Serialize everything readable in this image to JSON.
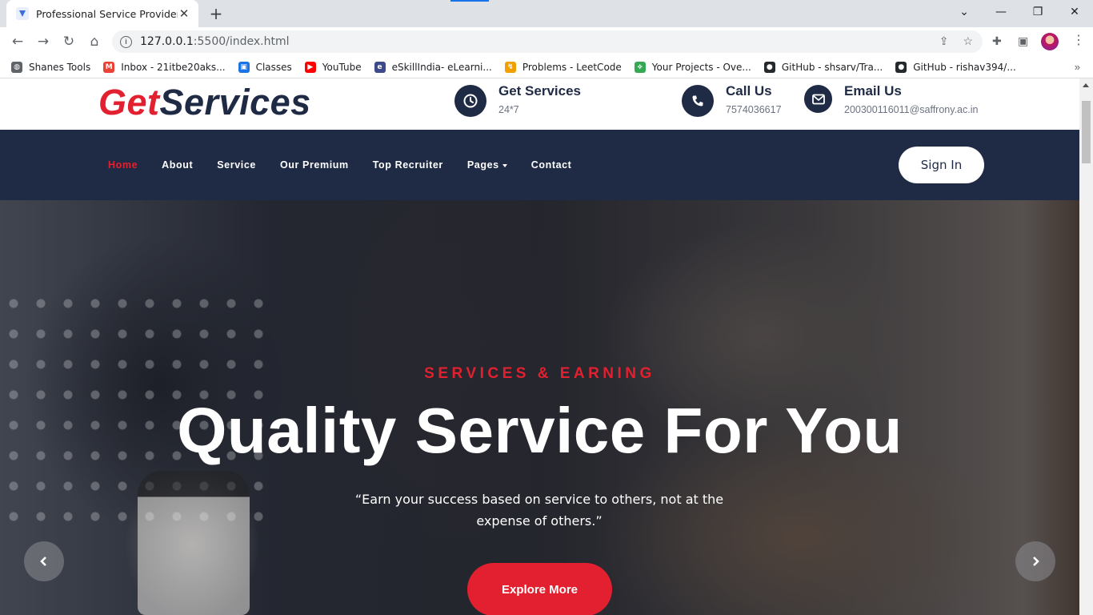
{
  "browser": {
    "tab_title": "Professional Service Provider",
    "url_host": "127.0.0.1",
    "url_path": ":5500/index.html",
    "bookmarks": [
      {
        "label": "Shanes Tools",
        "color": "#5f6368"
      },
      {
        "label": "Inbox - 21itbe20aks...",
        "color": "#ea4335"
      },
      {
        "label": "Classes",
        "color": "#1a73e8"
      },
      {
        "label": "YouTube",
        "color": "#ff0000"
      },
      {
        "label": "eSkillIndia- eLearni...",
        "color": "#3c4a8c"
      },
      {
        "label": "Problems - LeetCode",
        "color": "#f0a000"
      },
      {
        "label": "Your Projects - Ove...",
        "color": "#34a853"
      },
      {
        "label": "GitHub - shsarv/Tra...",
        "color": "#24292e"
      },
      {
        "label": "GitHub - rishav394/...",
        "color": "#24292e"
      }
    ],
    "bookmarks_more": "»"
  },
  "site": {
    "logo_part1": "Get",
    "logo_part2": "Services",
    "contacts": [
      {
        "title": "Get Services",
        "value": "24*7",
        "icon": "clock-icon"
      },
      {
        "title": "Call Us",
        "value": "7574036617",
        "icon": "phone-icon"
      },
      {
        "title": "Email Us",
        "value": "200300116011@saffrony.ac.in",
        "icon": "envelope-icon"
      }
    ],
    "nav": [
      "Home",
      "About",
      "Service",
      "Our Premium",
      "Top Recruiter",
      "Pages",
      "Contact"
    ],
    "signin": "Sign In"
  },
  "hero": {
    "tag": "SERVICES & EARNING",
    "headline": "Quality Service For You",
    "quote": "“Earn your success based on service to others, not at the expense of others.”",
    "button": "Explore More"
  },
  "colors": {
    "accent": "#e3202f",
    "navy": "#1f2a44"
  }
}
